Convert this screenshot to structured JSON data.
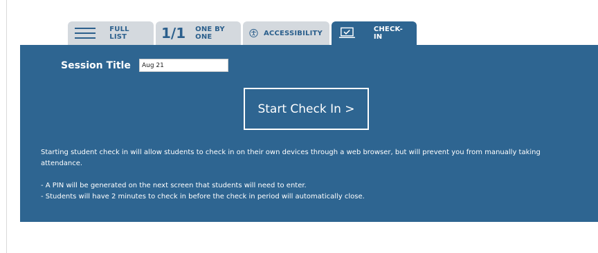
{
  "tabs": {
    "full_list": {
      "label": "FULL LIST",
      "icon": "hamburger-icon"
    },
    "one_by_one": {
      "glyph": "1/1",
      "label": "ONE BY ONE"
    },
    "accessibility": {
      "label": "ACCESSIBILITY",
      "icon": "accessibility-icon"
    },
    "check_in": {
      "label": "CHECK-IN",
      "icon": "laptop-check-icon",
      "active": true
    }
  },
  "session": {
    "title_label": "Session Title",
    "title_value": "Aug 21"
  },
  "start_button": {
    "label": "Start Check In >"
  },
  "info": {
    "paragraph": "Starting student check in will allow students to check in on their own devices through a web browser, but will prevent you from manually taking attendance.",
    "bullets": [
      "- A PIN will be generated on the next screen that students will need to enter.",
      "- Students will have 2 minutes to check in before the check in period will automatically close."
    ]
  },
  "colors": {
    "primary": "#2e6591",
    "tab_inactive": "#d4d9de",
    "tab_text": "#2b5f8c",
    "white": "#ffffff"
  }
}
